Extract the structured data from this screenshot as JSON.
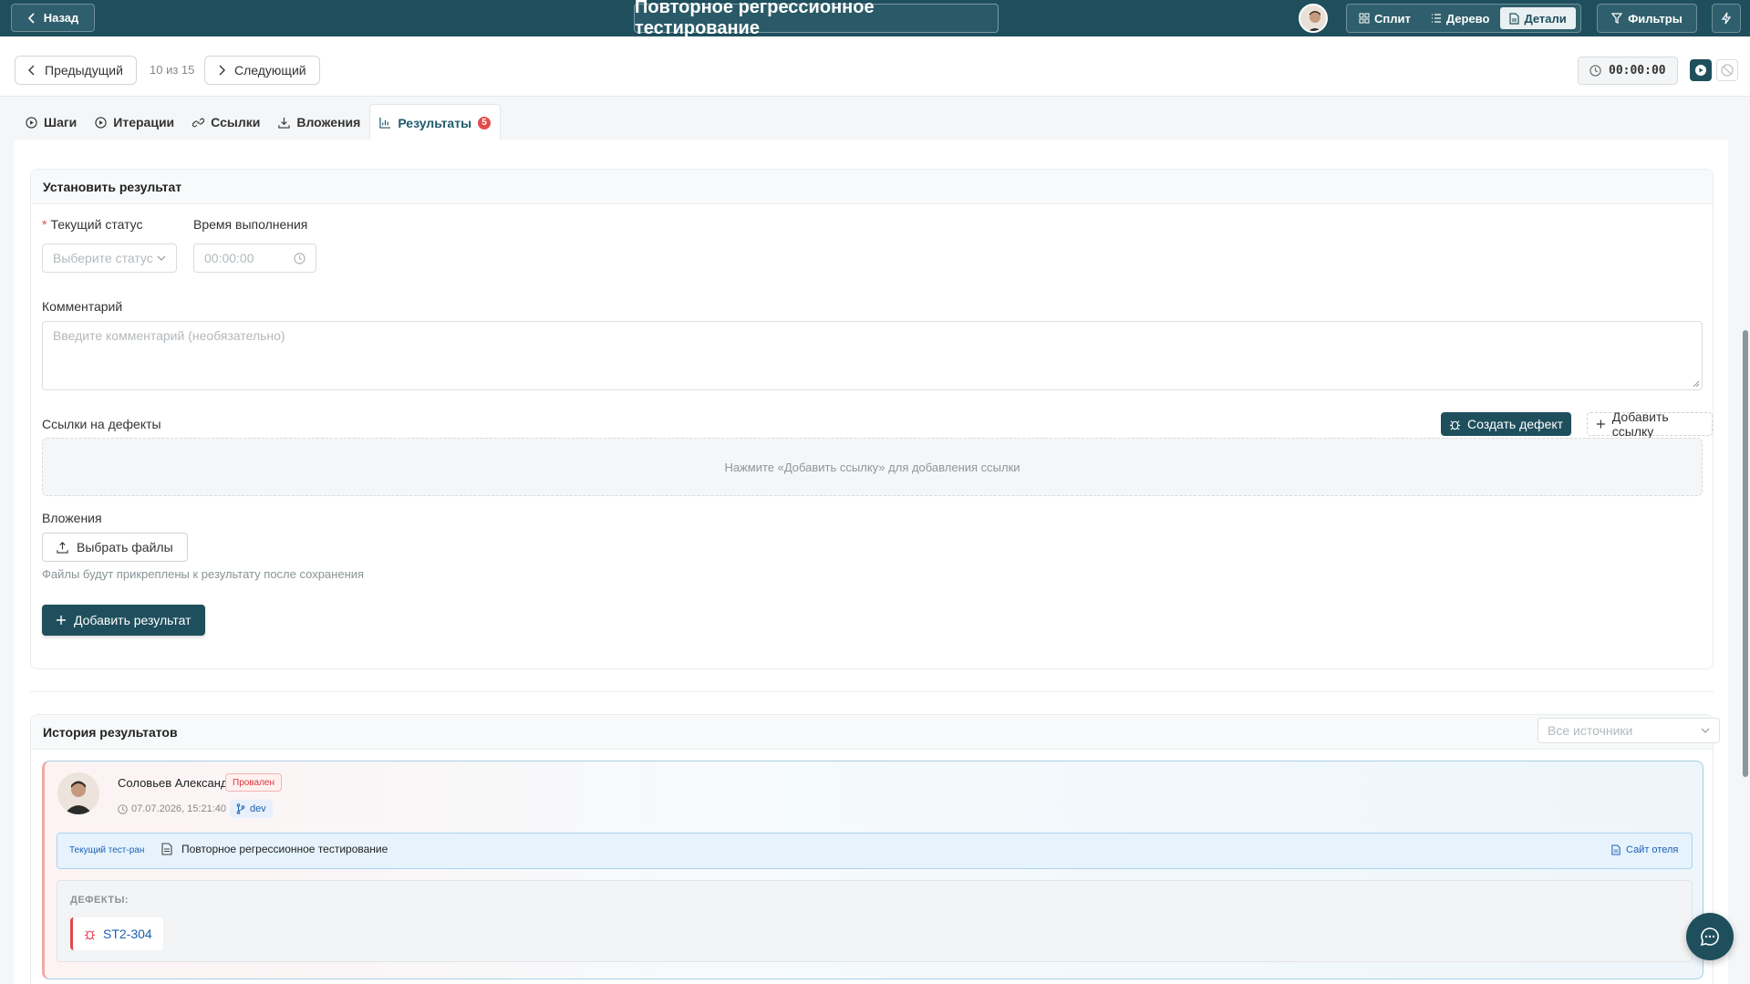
{
  "header": {
    "back_label": "Назад",
    "title": "Повторное регрессионное тестирование",
    "views": [
      {
        "label": "Сплит",
        "icon": "grid-icon"
      },
      {
        "label": "Дерево",
        "icon": "list-icon"
      },
      {
        "label": "Детали",
        "icon": "document-icon"
      }
    ],
    "active_view": "Детали",
    "filters_label": "Фильтры"
  },
  "navigation": {
    "prev_label": "Предыдущий",
    "position": "10 из 15",
    "next_label": "Следующий",
    "timer": "00:00:00"
  },
  "tabs": [
    {
      "label": "Шаги",
      "icon": "play-circle-icon"
    },
    {
      "label": "Итерации",
      "icon": "play-circle-icon"
    },
    {
      "label": "Ссылки",
      "icon": "link-icon"
    },
    {
      "label": "Вложения",
      "icon": "download-icon"
    },
    {
      "label": "Результаты",
      "icon": "bar-chart-icon",
      "badge": "5"
    }
  ],
  "set_result": {
    "title": "Установить результат",
    "status_label": "Текущий статус",
    "status_placeholder": "Выберите статус",
    "time_label": "Время выполнения",
    "time_placeholder": "00:00:00",
    "comment_label": "Комментарий",
    "comment_placeholder": "Введите комментарий (необязательно)",
    "defect_links_label": "Ссылки на дефекты",
    "create_defect_label": "Создать дефект",
    "add_link_label": "Добавить ссылку",
    "empty_links_text": "Нажмите «Добавить ссылку» для добавления ссылки",
    "attachments_label": "Вложения",
    "choose_files_label": "Выбрать файлы",
    "attachments_hint": "Файлы будут прикреплены к результату после сохранения",
    "add_result_label": "Добавить результат"
  },
  "history": {
    "title": "История результатов",
    "sources_placeholder": "Все источники",
    "items": [
      {
        "author": "Соловьев Александр",
        "status": "Провален",
        "timestamp": "07.07.2026, 15:21:40",
        "branch": "dev",
        "testrun_label": "Текущий тест-ран",
        "testrun_name": "Повторное регрессионное тестирование",
        "project": "Сайт отеля",
        "defects_title": "ДЕФЕКТЫ:",
        "defects": [
          "ST2-304"
        ]
      }
    ]
  },
  "colors": {
    "primary": "#1f4f5d",
    "failed": "#d9363e",
    "link": "#1c5fb4"
  }
}
